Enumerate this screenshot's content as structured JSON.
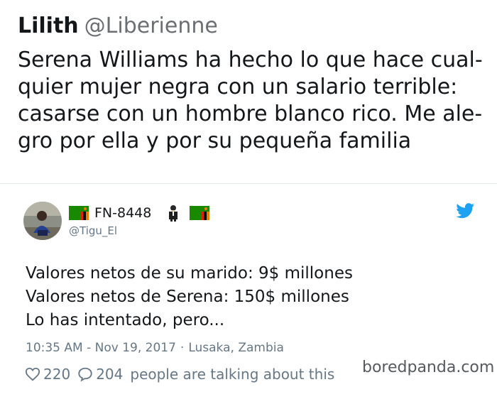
{
  "quoted_tweet": {
    "name": "Lilith",
    "handle": "@Liberienne",
    "text_lines": [
      "Serena Williams ha hecho lo que hace cual-",
      "quier mujer negra con un salario terrible:",
      "casarse con un hombre blanco rico. Me ale-",
      "gro por ella y por su pequeña familia"
    ]
  },
  "reply_tweet": {
    "name": "FN-8448",
    "handle": "@Tigu_El",
    "icons": {
      "flag": "zambia-flag-icon",
      "person": "man-in-suit-icon",
      "brand": "twitter-bird-icon",
      "like": "heart-icon",
      "reply": "speech-bubble-icon"
    },
    "text_lines": [
      "Valores netos de su marido: 9$ millones",
      "Valores netos de Serena: 150$ millones",
      "Lo has intentado, pero..."
    ],
    "timestamp": "10:35 AM - Nov 19, 2017",
    "separator": "·",
    "location": "Lusaka, Zambia",
    "likes": "220",
    "replies": "204",
    "talking_text": "people are talking about this"
  },
  "watermark": "boredpanda.com",
  "colors": {
    "text": "#14171a",
    "muted": "#657786",
    "twitter_blue": "#1da1f2",
    "divider": "#e1e8ed"
  }
}
